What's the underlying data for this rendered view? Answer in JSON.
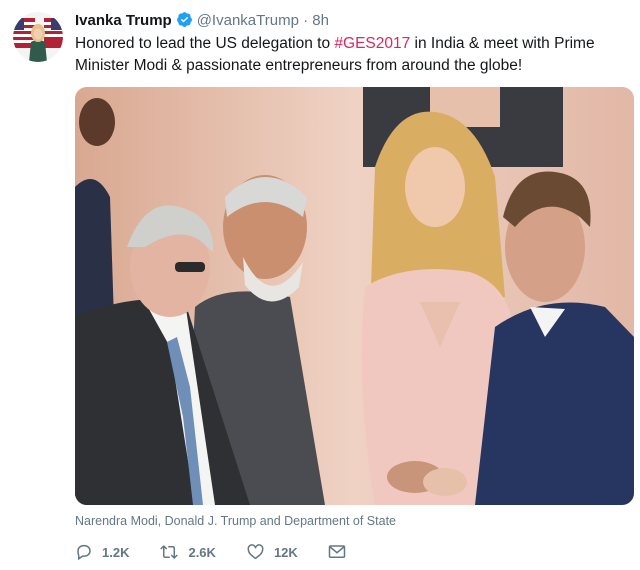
{
  "tweet": {
    "author_name": "Ivanka Trump",
    "handle": "@IvankaTrump",
    "separator": "·",
    "time": "8h",
    "text_part1": "Honored to lead the US delegation to ",
    "hashtag": "#GES2017",
    "text_part2": " in India & meet with Prime Minister Modi & passionate entrepreneurs from around the globe!",
    "media_caption": "Narendra Modi, Donald J. Trump and Department of State"
  },
  "actions": {
    "reply_count": "1.2K",
    "retweet_count": "2.6K",
    "like_count": "12K"
  },
  "colors": {
    "hashtag": "#e0245e",
    "verified": "#1da1f2",
    "muted": "#657786"
  },
  "icons": [
    "avatar",
    "verified-badge-icon",
    "reply-icon",
    "retweet-icon",
    "like-icon",
    "direct-message-icon"
  ]
}
